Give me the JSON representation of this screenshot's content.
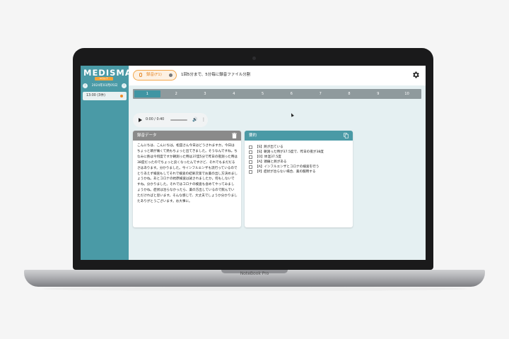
{
  "laptop": {
    "label": "NoteBook Pro"
  },
  "sidebar": {
    "logo": "MEDISMA",
    "logo_badge": "AIカルテ",
    "date": "2024年03月05日",
    "prev": "‹",
    "next": "›",
    "sessions": [
      {
        "time": "13:00 (3件)"
      }
    ]
  },
  "topbar": {
    "record_label": "録音(F1)",
    "info": "1回5分まで、5分毎に録音ファイル分割"
  },
  "pager": {
    "pages": [
      "1",
      "2",
      "3",
      "4",
      "5",
      "6",
      "7",
      "8",
      "9",
      "10"
    ],
    "active": 0
  },
  "player": {
    "time": "0:00 / 0:40",
    "volume": "🔊",
    "more": "⋮"
  },
  "recording_card": {
    "title": "録音データ",
    "text": "こんにちは、こんにちは。松田さん今日はどうされますか。今日はちょっと頭が痛くて熱もちょっと出てきました。そうなんですね。ちなみに熱は今何度ですか朝測った時は37度5分で昨日の夜測った時は38度だったのでちょっと良くなったんですけど、それでもまだだるさはあります。分かりました。今インフルエンザも流行っているのでとりあえず検査もしてそれで検査の結果次第でお薬の出し方決めましょうかね。あとコロナの抗原検査は試されましたか。何もしないですね。分かりました。それではコロナの検査も含めてやってみましょうかね。症状は治らなかったら、薬の方出しているので飲んでいただければと思います。そんな感じで、大丈夫でしょうか分かりましたありがとうございます。お大事に。"
  },
  "summary_card": {
    "title": "要約",
    "items": [
      "【S】熱が出ている",
      "【S】朝測った時が37.5度で、昨日の夜が38度",
      "【O】体温37.5度",
      "【A】頭痛と熱がある",
      "【A】インフルエンザとコロナの検査を行う",
      "【P】症状が治らない場合、薬の服用する"
    ]
  },
  "colors": {
    "teal": "#4a9aa6",
    "orange": "#f08a24",
    "card_header_recording": "#8a8a8a",
    "card_header_summary": "#4a9aa6"
  }
}
